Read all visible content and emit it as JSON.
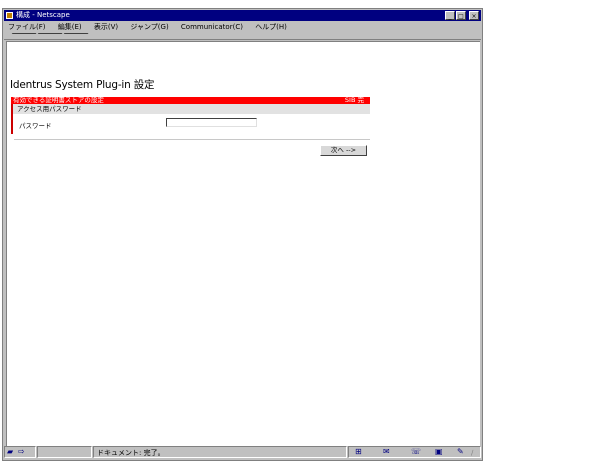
{
  "window": {
    "title": "構成 - Netscape",
    "buttons": {
      "minimize": "_",
      "maximize": "□",
      "close": "×"
    }
  },
  "menubar": {
    "items": [
      "ファイル(F)",
      "編集(E)",
      "表示(V)",
      "ジャンプ(G)",
      "Communicator(C)",
      "ヘルプ(H)"
    ]
  },
  "page": {
    "title": "Identrus System Plug-in 設定",
    "section_header_left": "有効できる証明書ストアの設定",
    "section_header_right": "SIB 完",
    "subheader": "アクセス用パスワード",
    "password_label": "パスワード",
    "password_value": "",
    "next_button": "次へ -->"
  },
  "statusbar": {
    "text": "ドキュメント: 完了。"
  },
  "colors": {
    "titlebar": "#000080",
    "header_red": "#ff0000",
    "chrome": "#c0c0c0"
  }
}
